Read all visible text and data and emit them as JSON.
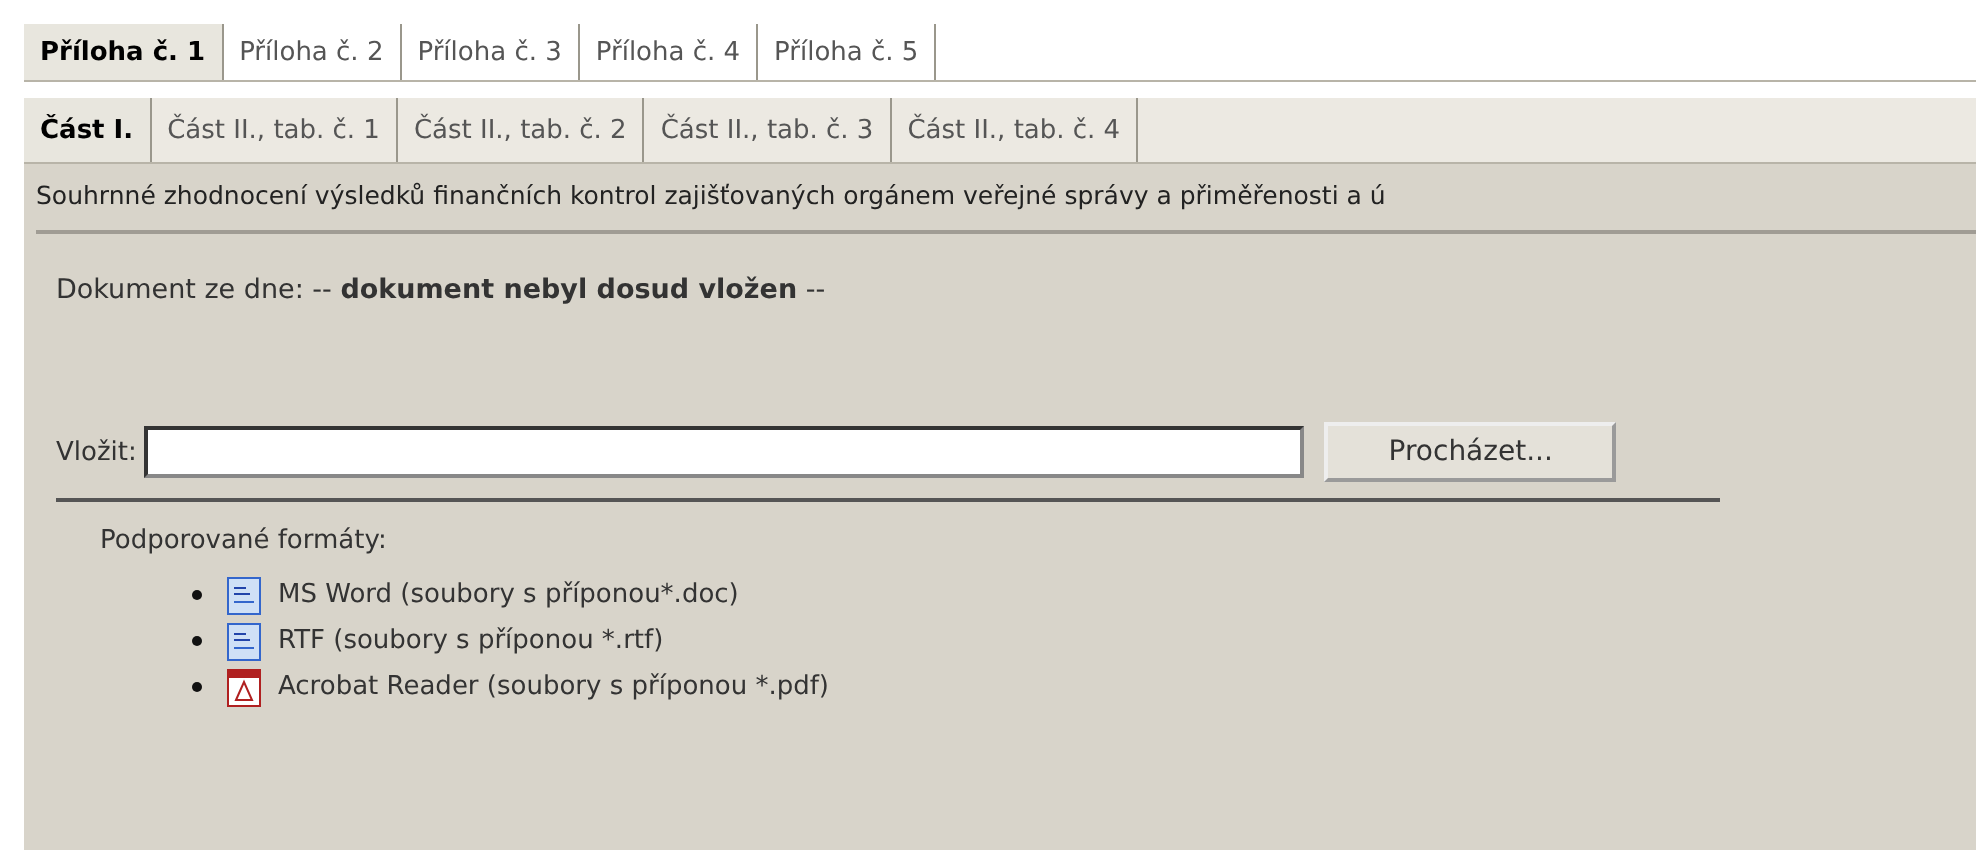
{
  "tabs": [
    {
      "label": "Příloha č. 1",
      "selected": true
    },
    {
      "label": "Příloha č. 2",
      "selected": false
    },
    {
      "label": "Příloha č. 3",
      "selected": false
    },
    {
      "label": "Příloha č. 4",
      "selected": false
    },
    {
      "label": "Příloha č. 5",
      "selected": false
    }
  ],
  "subtabs": [
    {
      "label": "Část I.",
      "selected": true
    },
    {
      "label": "Část II., tab. č. 1",
      "selected": false
    },
    {
      "label": "Část II., tab. č. 2",
      "selected": false
    },
    {
      "label": "Část II., tab. č. 3",
      "selected": false
    },
    {
      "label": "Část II., tab. č. 4",
      "selected": false
    }
  ],
  "description": "Souhrnné zhodnocení výsledků finančních kontrol zajišťovaných orgánem veřejné správy a přiměřenosti a ú",
  "document_status": "Dokument ze dne: -- **dokument nebyl dosud vložen** --",
  "upload": {
    "label": "Vložit:",
    "button": "Procházet..."
  },
  "formats": {
    "title": "Podporované formáty:",
    "items": [
      {
        "kind": "word",
        "label": "MS Word (soubory s příponou*.doc)"
      },
      {
        "kind": "word",
        "label": "RTF (soubory s příponou *.rtf)"
      },
      {
        "kind": "pdf",
        "label": "Acrobat Reader (soubory s příponou *.pdf)"
      }
    ]
  }
}
